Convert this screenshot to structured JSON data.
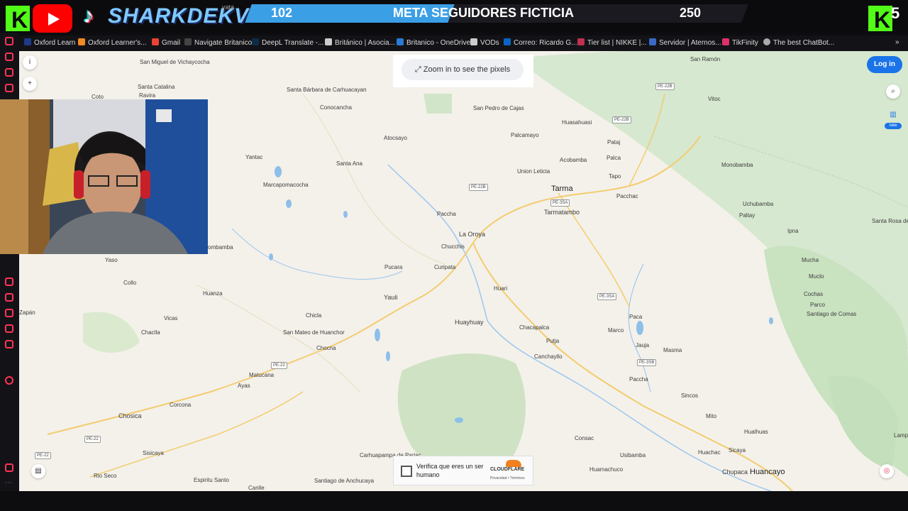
{
  "overlay": {
    "channel_name": "SHARKDEKV",
    "goal_current": "102",
    "goal_title": "META SEGUIDORES FICTICIA",
    "goal_target": "250",
    "goal_progress": 0.408,
    "right_counter": "5",
    "mini_text": "yata",
    "colors": {
      "kick_green": "#53fc18",
      "youtube_red": "#ff0000",
      "goal_blue": "#3b9fe6"
    }
  },
  "bookmarks": [
    {
      "label": "Oxford Learn",
      "icon": "oup-icon"
    },
    {
      "label": "Oxford Learner's...",
      "icon": "oxford-icon"
    },
    {
      "label": "Gmail",
      "icon": "gmail-icon"
    },
    {
      "label": "Navigate Britanico",
      "icon": "dil-icon"
    },
    {
      "label": "DeepL Translate -...",
      "icon": "deepl-icon"
    },
    {
      "label": "Británico | Asocia...",
      "icon": "page-icon"
    },
    {
      "label": "Britanico - OneDrive",
      "icon": "onedrive-icon"
    },
    {
      "label": "VODs",
      "icon": "page-icon"
    },
    {
      "label": "Correo: Ricardo G...",
      "icon": "outlook-icon"
    },
    {
      "label": "Tier list | NIKKE |...",
      "icon": "tier-icon"
    },
    {
      "label": "Servidor | Aternos...",
      "icon": "aternos-icon"
    },
    {
      "label": "TikFinity",
      "icon": "tikfinity-icon"
    },
    {
      "label": "The best ChatBot...",
      "icon": "chatbot-icon"
    }
  ],
  "map": {
    "zoom_hint": "Zoom in to see the pixels",
    "login": "Log in",
    "new_badge": "new",
    "info_btn": "i",
    "zoom_in_btn": "+",
    "places": [
      "San Miguel de Vichaycocha",
      "Santa Catalina",
      "Ravira",
      "Coto",
      "Santa Bárbara de Carhuacayan",
      "Conocancha",
      "San Pedro de Cajas",
      "Huasahuasi",
      "San Ramón",
      "Vitoc",
      "Palcamayo",
      "Atocsayo",
      "Yantac",
      "Santa Ana",
      "Acobamba",
      "Pataj",
      "Palca",
      "Tapo",
      "Union Leticia",
      "Tarma",
      "Marcapomacocha",
      "Monobamba",
      "Pacchac",
      "Uchubamba",
      "Tarmatambo",
      "Paltay",
      "Paccha",
      "Ipna",
      "La Oroya",
      "Santa Rosa de Toldopampa",
      "Chucchis",
      "Yaso",
      "Pucara",
      "Curipata",
      "Mucha",
      "Muclo",
      "Collo",
      "Huanza",
      "Huari",
      "Yauli",
      "Cochas",
      "Parco",
      "Santiago de Comas",
      "Zapán",
      "Chicla",
      "Vicas",
      "Huayhuay",
      "Paca",
      "Chacapalca",
      "Marco",
      "Chaclla",
      "San Mateo de Huanchor",
      "Putja",
      "Jauja",
      "Masma",
      "Chocna",
      "Canchayllo",
      "Matucana",
      "Paccha",
      "Ayas",
      "Sincos",
      "Chosica",
      "Corcona",
      "Mito",
      "Hualhuas",
      "Consac",
      "Sicaya",
      "Sisicaya",
      "Carhuapampa de Pariac",
      "Usibamba",
      "Huachac",
      "Rio Seco",
      "Huamachuco",
      "Chupaca",
      "Huancayo",
      "Espiritu Santo",
      "Santiago de Anchucaya",
      "Canlle",
      "ombamba",
      "Lamp"
    ],
    "roads": [
      "PE-22B",
      "PE-22B",
      "PE-22B",
      "PE-3SA",
      "PE-3SA",
      "PE-3SB",
      "PE-22",
      "PE-22",
      "PE-22"
    ]
  },
  "captcha": {
    "text": "Verifica que eres un ser humano",
    "brand": "CLOUDFLARE",
    "links": "Privacidad • Términos"
  }
}
